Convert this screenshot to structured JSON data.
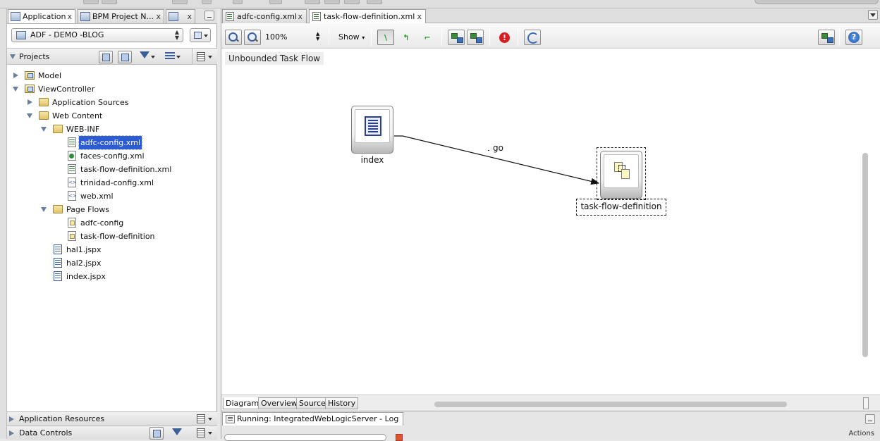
{
  "left_tabs": [
    {
      "label": "Application",
      "close": "x"
    },
    {
      "label": "BPM Project N...",
      "close": "x"
    },
    {
      "label": "",
      "close": "x"
    }
  ],
  "application_selector": {
    "value": "ADF - DEMO -BLOG"
  },
  "projects_panel": {
    "title": "Projects"
  },
  "tree": {
    "model": "Model",
    "viewcontroller": "ViewController",
    "application_sources": "Application Sources",
    "web_content": "Web Content",
    "web_inf": "WEB-INF",
    "adfc_config_xml": "adfc-config.xml",
    "faces_config_xml": "faces-config.xml",
    "task_flow_definition_xml": "task-flow-definition.xml",
    "trinidad_config_xml": "trinidad-config.xml",
    "web_xml": "web.xml",
    "page_flows": "Page Flows",
    "adfc_config": "adfc-config",
    "task_flow_definition": "task-flow-definition",
    "hal1": "hal1.jspx",
    "hal2": "hal2.jspx",
    "index": "index.jspx"
  },
  "bottom_sections": {
    "application_resources": "Application Resources",
    "data_controls": "Data Controls"
  },
  "editor_tabs": [
    {
      "label": "adfc-config.xml",
      "close": "x"
    },
    {
      "label": "task-flow-definition.xml",
      "close": "x"
    }
  ],
  "toolbar": {
    "zoom_value": "100%",
    "show_label": "Show",
    "error_glyph": "!",
    "help_glyph": "?"
  },
  "diagram": {
    "flow_label": "Unbounded Task Flow",
    "activity_index": "index",
    "activity_task_flow": "task-flow-definition",
    "control_flow_label": "go"
  },
  "bottom_tabs": [
    "Diagram",
    "Overview",
    "Source",
    "History"
  ],
  "log_panel": {
    "tab_label": "Running: IntegratedWebLogicServer - Log",
    "actions_label": "Actions"
  }
}
